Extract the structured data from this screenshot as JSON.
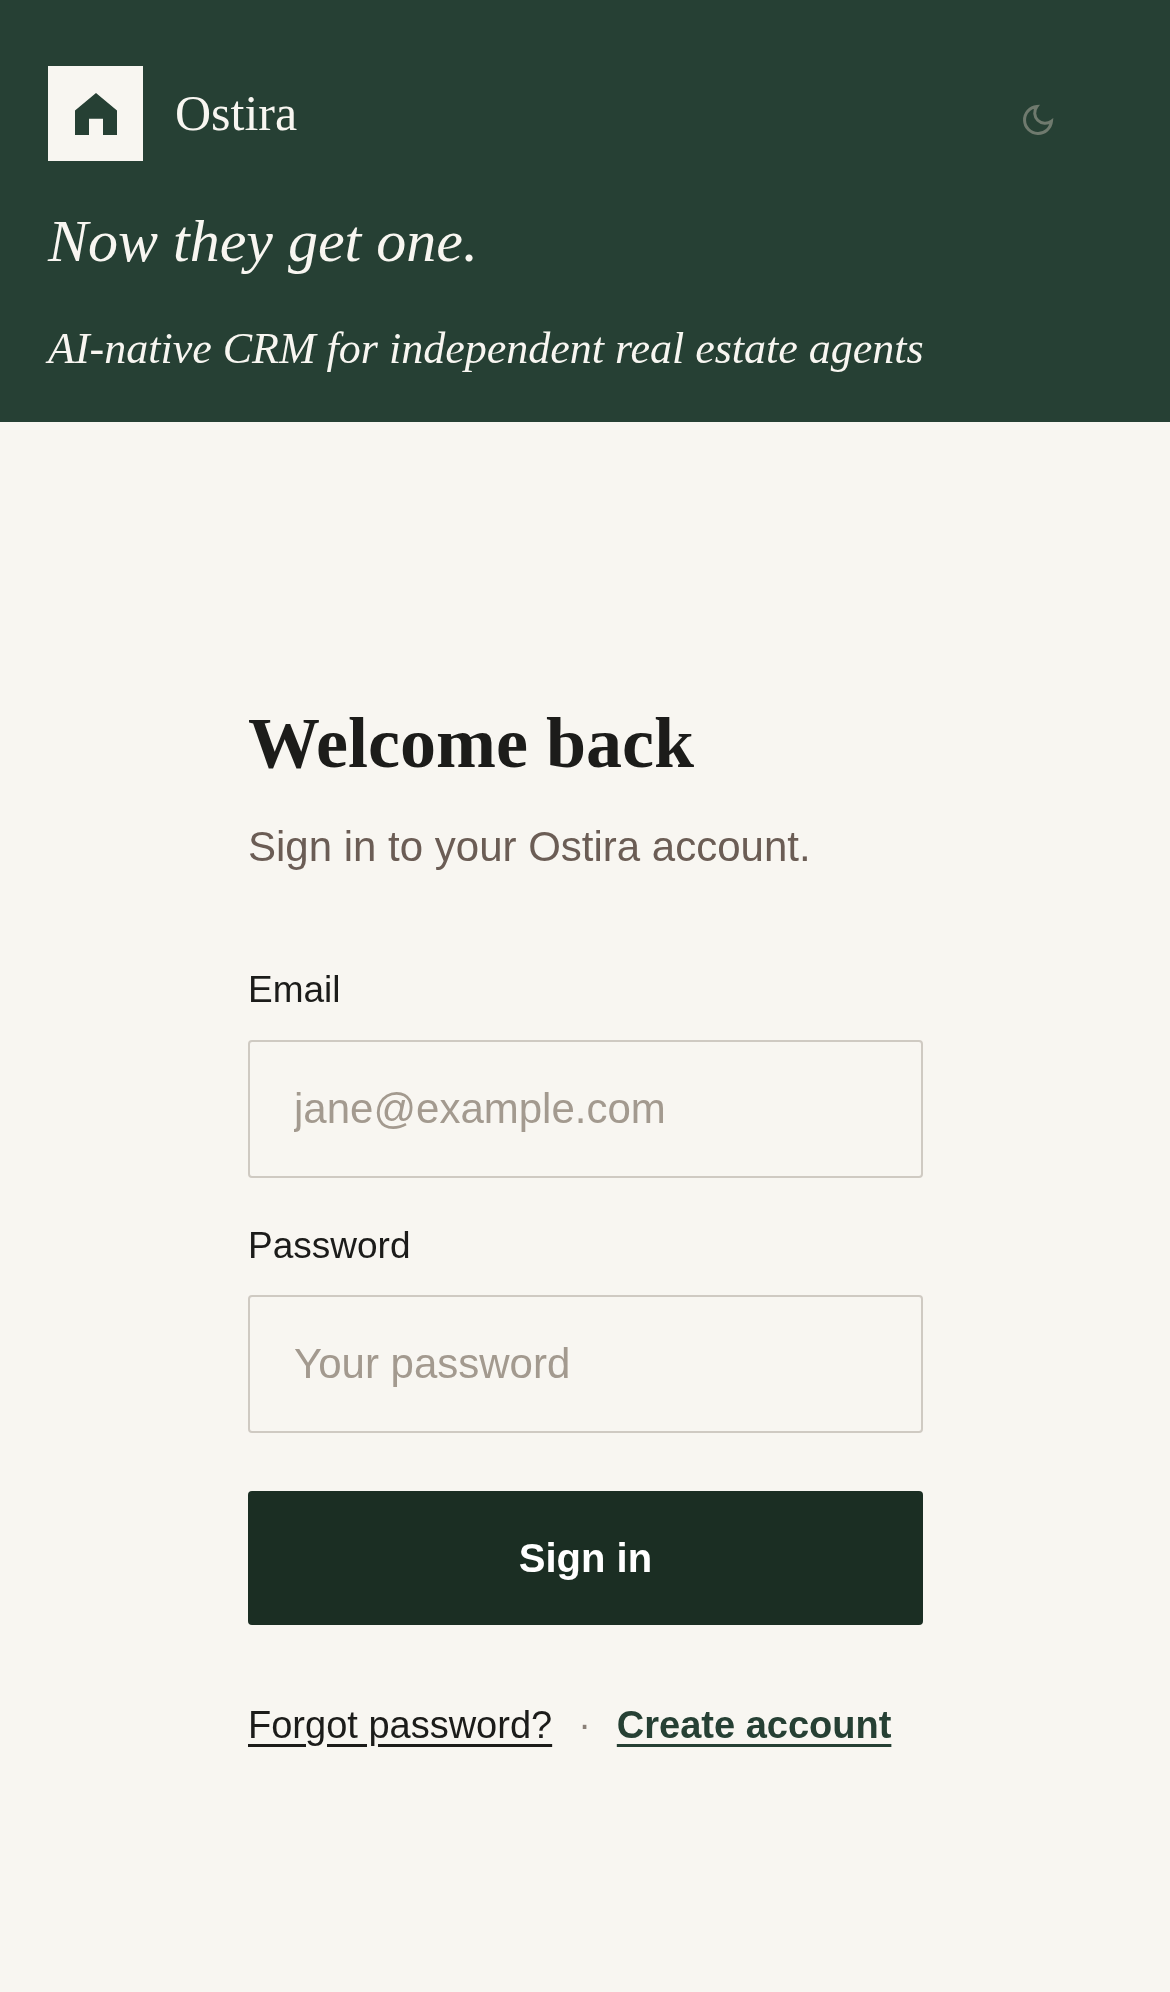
{
  "header": {
    "brand": "Ostira",
    "tagline": "Now they get one.",
    "subtitle": "AI-native CRM for independent real estate agents",
    "dark_mode": false
  },
  "form": {
    "title": "Welcome back",
    "subtitle": "Sign in to your Ostira account.",
    "fields": [
      {
        "label": "Email",
        "placeholder": "jane@example.com"
      },
      {
        "label": "Password",
        "placeholder": "Your password"
      }
    ],
    "submit": "Sign in",
    "links": [
      {
        "label": "Forgot password?",
        "kind": "plain"
      },
      {
        "label": "Create account",
        "kind": "primary"
      }
    ],
    "separator": "·"
  }
}
